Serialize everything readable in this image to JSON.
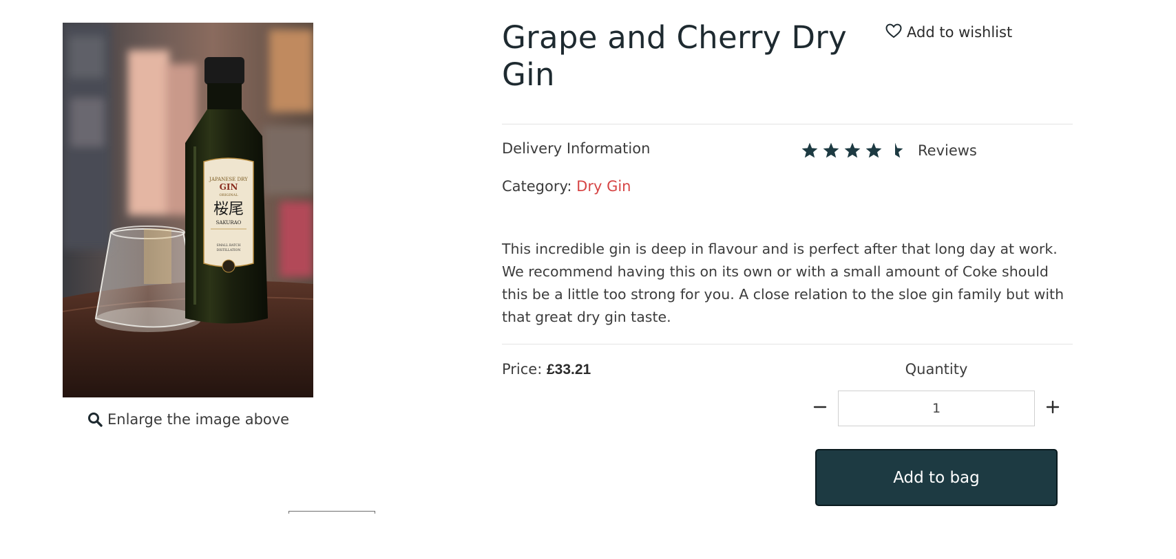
{
  "product": {
    "title": "Grape and Cherry Dry Gin",
    "image": {
      "enlarge_label": "Enlarge the image above",
      "bottle_label_lines": [
        "JAPANESE DRY",
        "GIN",
        "ORIGINAL",
        "桜尾",
        "SAKURAO",
        "SMALL BATCH",
        "DISTILLATION"
      ]
    },
    "wishlist_label": "Add to wishlist",
    "delivery_label": "Delivery Information",
    "rating": {
      "value": 4.5,
      "max": 5,
      "reviews_label": "Reviews"
    },
    "category_prefix": "Category:",
    "category_name": "Dry Gin",
    "description": "This incredible gin is deep in flavour and is perfect after that long day at work. We recommend having this on its own or with a small amount of Coke should this be a little too strong for you. A close relation to the sloe gin family but with that great dry gin taste.",
    "price_prefix": "Price:",
    "price": "£33.21",
    "quantity": {
      "label": "Quantity",
      "value": "1"
    },
    "add_to_bag_label": "Add to bag"
  },
  "colors": {
    "accent_dark": "#1d3a42",
    "star": "#1d3a42",
    "category_link": "#d64545",
    "title": "#1e2a30"
  }
}
